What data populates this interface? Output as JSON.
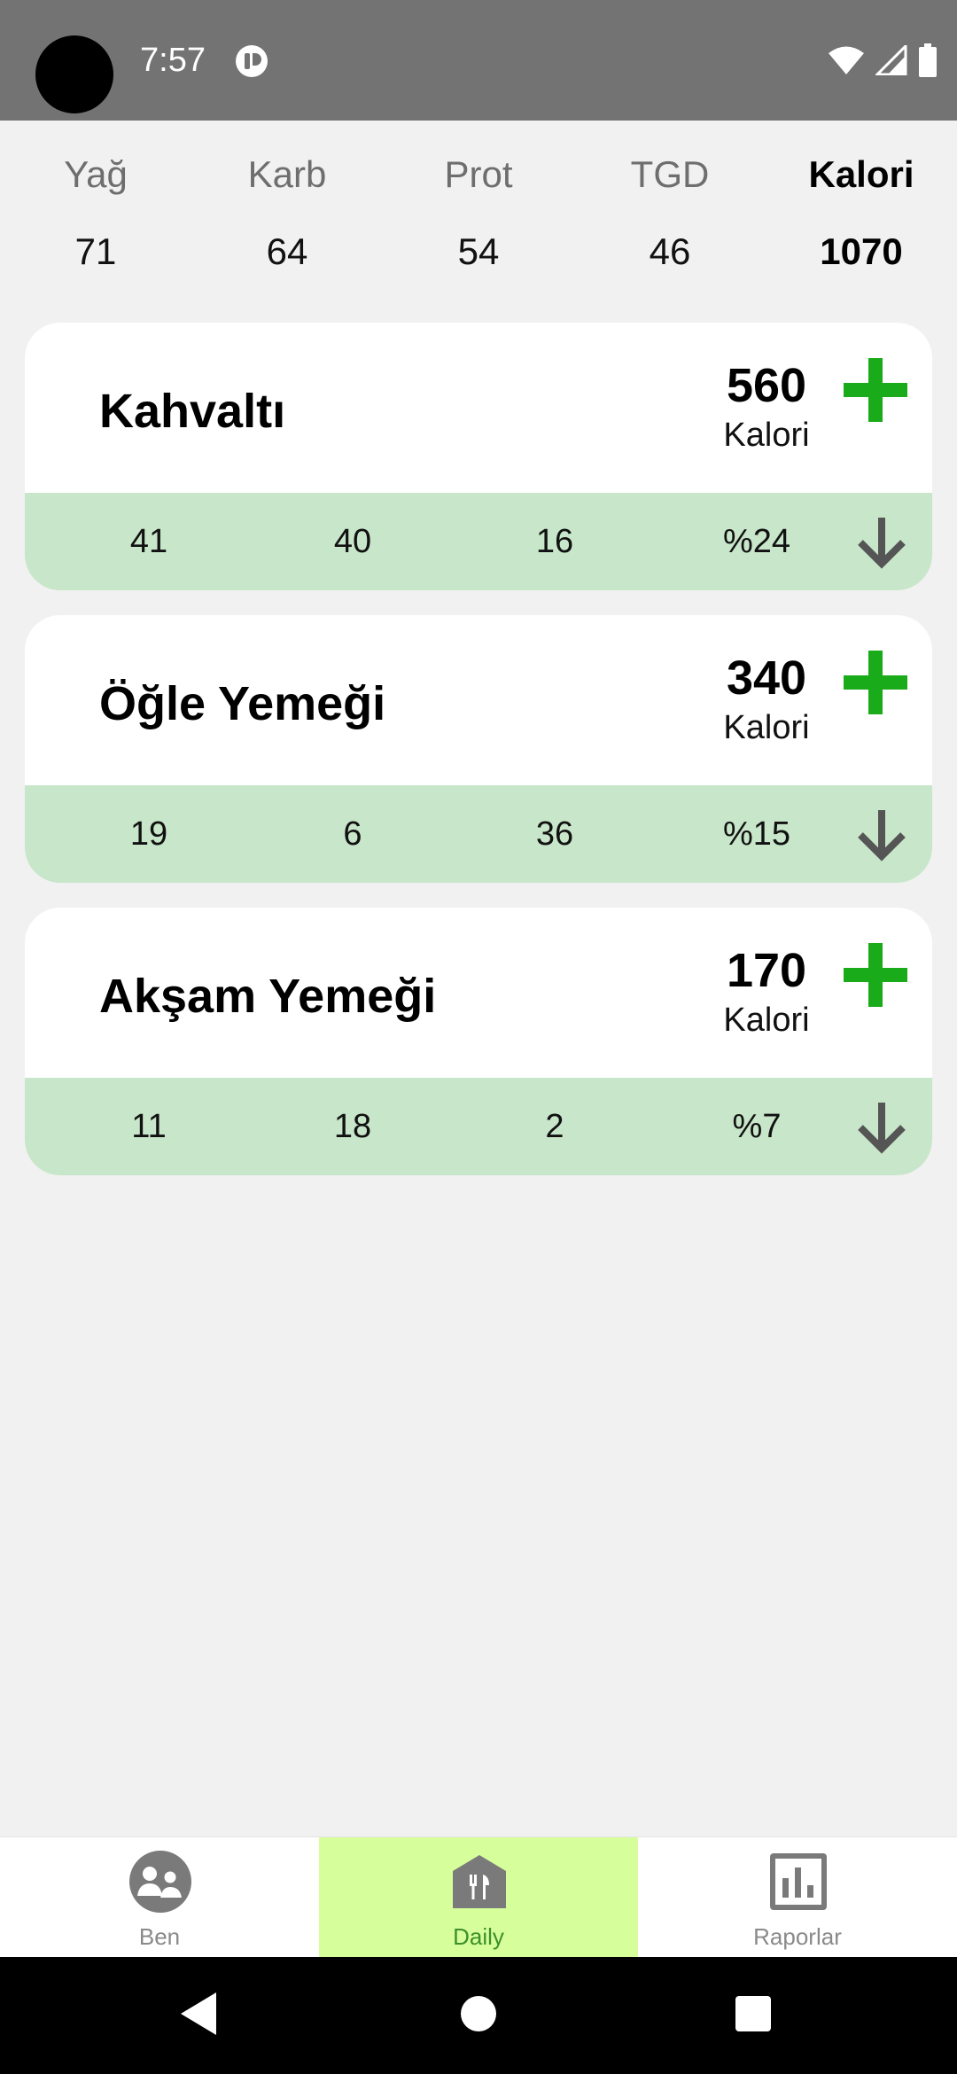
{
  "status_bar": {
    "time": "7:57"
  },
  "summary": {
    "columns": [
      {
        "label": "Yağ",
        "value": "71"
      },
      {
        "label": "Karb",
        "value": "64"
      },
      {
        "label": "Prot",
        "value": "54"
      },
      {
        "label": "TGD",
        "value": "46"
      },
      {
        "label": "Kalori",
        "value": "1070"
      }
    ],
    "active_column": "Kalori"
  },
  "meals": [
    {
      "name": "Kahvaltı",
      "calories": "560",
      "calorie_unit": "Kalori",
      "stats": [
        "41",
        "40",
        "16",
        "%24"
      ]
    },
    {
      "name": "Öğle Yemeği",
      "calories": "340",
      "calorie_unit": "Kalori",
      "stats": [
        "19",
        "6",
        "36",
        "%15"
      ]
    },
    {
      "name": "Akşam Yemeği",
      "calories": "170",
      "calorie_unit": "Kalori",
      "stats": [
        "11",
        "18",
        "2",
        "%7"
      ]
    }
  ],
  "bottom_nav": {
    "items": [
      {
        "label": "Ben",
        "icon": "people-icon"
      },
      {
        "label": "Daily",
        "icon": "dining-icon"
      },
      {
        "label": "Raporlar",
        "icon": "bar-chart-icon"
      }
    ],
    "active": "Daily"
  },
  "colors": {
    "status_bar": "#737373",
    "background": "#f1f1f1",
    "accent_green": "#1aab1a",
    "stats_band": "#c8e6c9",
    "nav_active": "#d6ff9c",
    "nav_active_label": "#3d8f2a",
    "arrow_gray": "#555555"
  }
}
